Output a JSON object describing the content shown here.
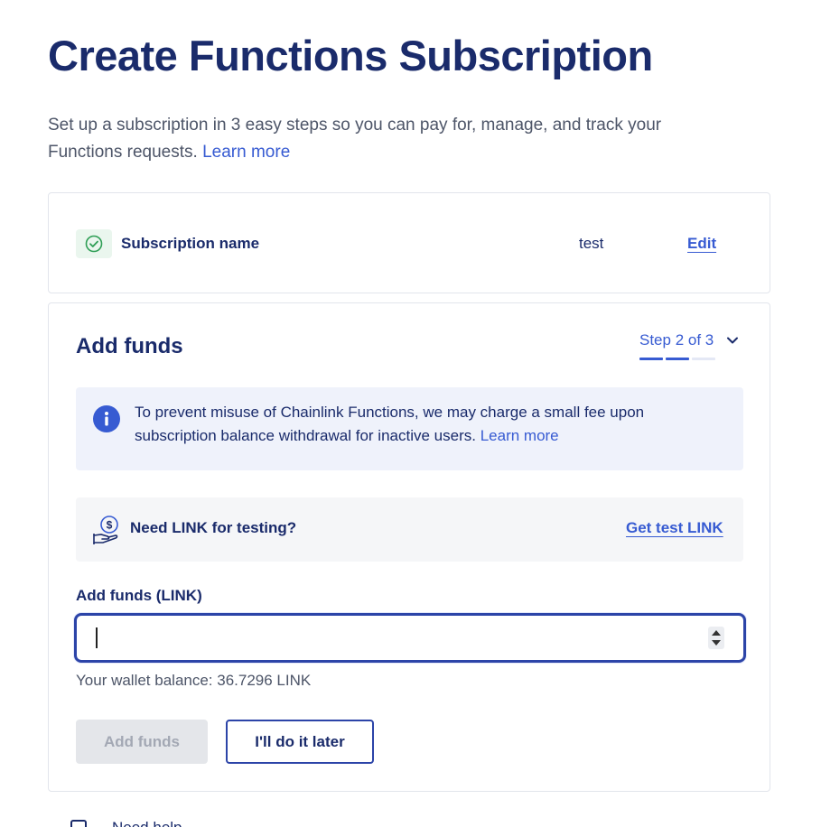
{
  "page": {
    "title": "Create Functions Subscription",
    "intro": "Set up a subscription in 3 easy steps so you can pay for, manage, and track your Functions requests.",
    "intro_link": "Learn more"
  },
  "step_done": {
    "label": "Subscription name",
    "value": "test",
    "edit_label": "Edit",
    "status_color": "#2e9e55",
    "icon": "check-circle-icon"
  },
  "step_active": {
    "title": "Add funds",
    "step_label": "Step 2 of 3",
    "current_step": 2,
    "total_steps": 3,
    "info": {
      "icon": "info-icon",
      "text": "To prevent misuse of Chainlink Functions, we may charge a small fee upon subscription balance withdrawal for inactive users.",
      "link": "Learn more"
    },
    "test_link": {
      "icon": "money-hand-icon",
      "label": "Need LINK for testing?",
      "link": "Get test LINK"
    },
    "amount_field": {
      "label": "Add funds (LINK)",
      "value": "",
      "placeholder": ""
    },
    "wallet_balance": "Your wallet balance: 36.7296 LINK",
    "primary_button": "Add funds",
    "secondary_button": "I'll do it later"
  },
  "footer_row": {
    "text": "Need help..."
  },
  "colors": {
    "navy": "#1a2b6b",
    "accent": "#375bd2",
    "success": "#2e9e55"
  }
}
